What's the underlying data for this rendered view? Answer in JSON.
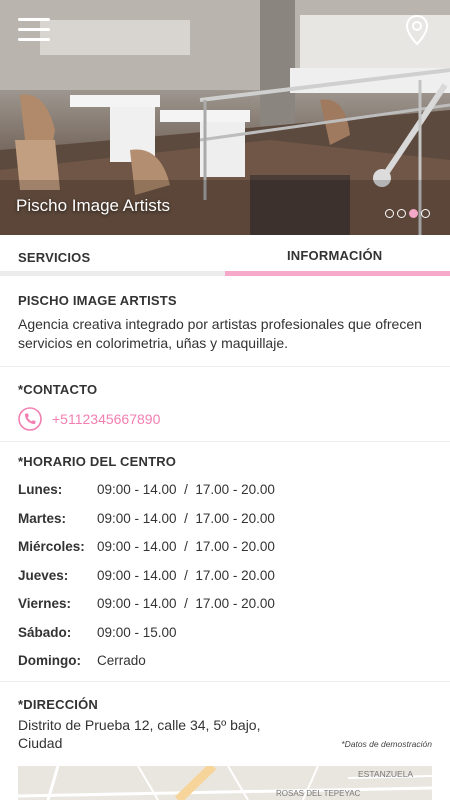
{
  "hero": {
    "title": "Pischo Image Artists",
    "menu_icon": "hamburger-menu-icon",
    "location_icon": "map-pin-icon",
    "slides": 4,
    "active_slide": 3
  },
  "tabs": [
    {
      "label": "SERVICIOS",
      "active": false
    },
    {
      "label": "INFORMACIÓN",
      "active": true
    }
  ],
  "about": {
    "heading": "PISCHO IMAGE ARTISTS",
    "description": "Agencia creativa integrado por artistas profesionales que ofrecen servicios en colorimetria, uñas y maquillaje."
  },
  "contact": {
    "heading": "*CONTACTO",
    "phone": "+5112345667890",
    "icon": "phone-icon"
  },
  "schedule": {
    "heading": "*HORARIO DEL CENTRO",
    "rows": [
      {
        "day": "Lunes:",
        "hours": "09:00 - 14.00  /  17.00 - 20.00"
      },
      {
        "day": "Martes:",
        "hours": "09:00 - 14.00  /  17.00 - 20.00"
      },
      {
        "day": "Miércoles:",
        "hours": "09:00 - 14.00  /  17.00 - 20.00"
      },
      {
        "day": "Jueves:",
        "hours": "09:00 - 14.00  /  17.00 - 20.00"
      },
      {
        "day": "Viernes:",
        "hours": "09:00 - 14.00  /  17.00 - 20.00"
      },
      {
        "day": "Sábado:",
        "hours": "09:00 - 15.00"
      },
      {
        "day": "Domingo:",
        "hours": "Cerrado"
      }
    ]
  },
  "address": {
    "heading": "*DIRECCIÓN",
    "text": "Distrito de Prueba 12, calle 34, 5º bajo, Ciudad",
    "note": "*Datos de demostración"
  },
  "map": {
    "labels": [
      "ESTANZUELA",
      "ROSAS DEL TEPEYAC"
    ]
  },
  "colors": {
    "accent": "#f6a9c8",
    "link": "#f17fb1"
  }
}
